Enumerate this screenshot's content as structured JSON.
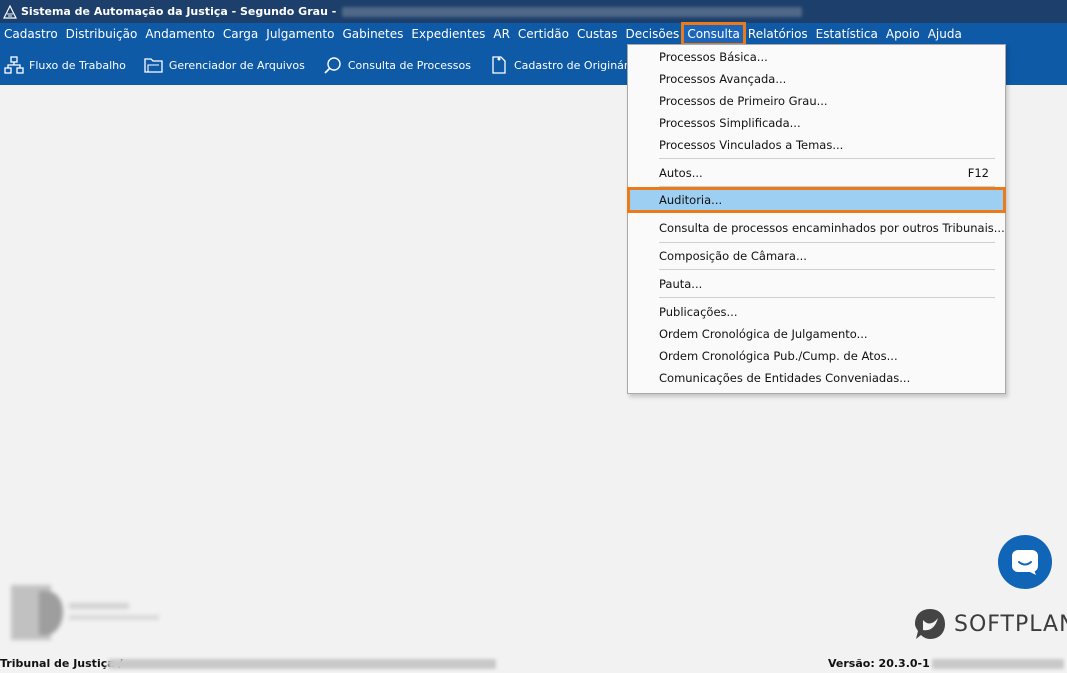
{
  "window": {
    "title": "Sistema de Automação da Justiça - Segundo Grau -"
  },
  "menubar": {
    "items": [
      "Cadastro",
      "Distribuição",
      "Andamento",
      "Carga",
      "Julgamento",
      "Gabinetes",
      "Expedientes",
      "AR",
      "Certidão",
      "Custas",
      "Decisões",
      "Consulta",
      "Relatórios",
      "Estatística",
      "Apoio",
      "Ajuda"
    ],
    "active": "Consulta"
  },
  "toolbar": {
    "items": [
      {
        "label": "Fluxo de Trabalho",
        "icon": "workflow-icon"
      },
      {
        "label": "Gerenciador de Arquivos",
        "icon": "folder-icon"
      },
      {
        "label": "Consulta de Processos",
        "icon": "search-icon"
      },
      {
        "label": "Cadastro de Originários",
        "icon": "document-icon"
      }
    ]
  },
  "dropdown": {
    "items": [
      {
        "label": "Processos Básica...",
        "shortcut": ""
      },
      {
        "label": "Processos Avançada...",
        "shortcut": ""
      },
      {
        "label": "Processos de Primeiro Grau...",
        "shortcut": ""
      },
      {
        "label": "Processos Simplificada...",
        "shortcut": ""
      },
      {
        "label": "Processos Vinculados a Temas...",
        "shortcut": ""
      },
      {
        "label": "Autos...",
        "shortcut": "F12"
      },
      {
        "label": "Auditoria...",
        "shortcut": "",
        "highlighted": true
      },
      {
        "label": "Consulta de processos encaminhados por outros Tribunais...",
        "shortcut": ""
      },
      {
        "label": "Composição de Câmara...",
        "shortcut": ""
      },
      {
        "label": "Pauta...",
        "shortcut": ""
      },
      {
        "label": "Publicações...",
        "shortcut": ""
      },
      {
        "label": "Ordem Cronológica de Julgamento...",
        "shortcut": ""
      },
      {
        "label": "Ordem Cronológica Pub./Cump. de Atos...",
        "shortcut": ""
      },
      {
        "label": "Comunicações de Entidades Conveniadas...",
        "shortcut": ""
      }
    ]
  },
  "brand": {
    "name": "SOFTPLAN"
  },
  "status": {
    "left": "Tribunal de Justiça /",
    "version": "Versão: 20.3.0-1"
  },
  "colors": {
    "menubar": "#0e5aa7",
    "titlebar": "#1d3f6b",
    "highlight": "#9ccff2",
    "focus_outline": "#ea7a1a",
    "chat_bubble": "#1065b6"
  }
}
